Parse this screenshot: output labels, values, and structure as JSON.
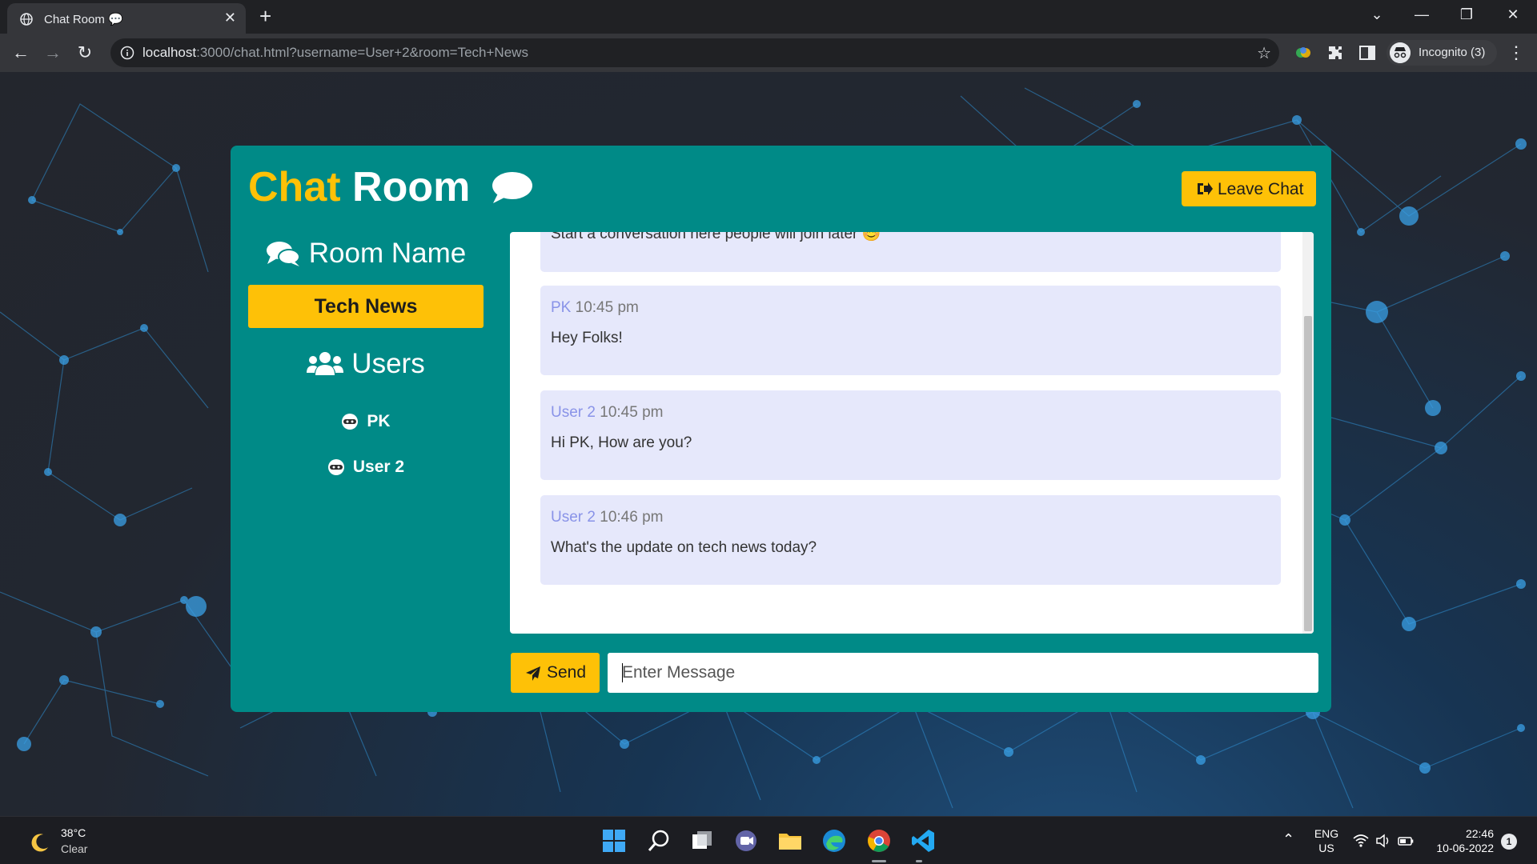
{
  "browser": {
    "tab_title": "Chat Room 💬",
    "tab_close": "✕",
    "new_tab": "+",
    "url_host": "localhost",
    "url_rest": ":3000/chat.html?username=User+2&room=Tech+News",
    "incognito_label": "Incognito (3)",
    "window_controls": [
      "⌄",
      "—",
      "❐",
      "✕"
    ]
  },
  "app": {
    "title_part1": "Chat",
    "title_part2": "Room",
    "leave_label": "Leave Chat",
    "room_heading": "Room Name",
    "room_name": "Tech News",
    "users_heading": "Users",
    "users": [
      "PK",
      "User 2"
    ],
    "partial_message": "Start a conversation here people will join later 😊",
    "messages": [
      {
        "user": "PK",
        "time": "10:45 pm",
        "text": "Hey Folks!"
      },
      {
        "user": "User 2",
        "time": "10:45 pm",
        "text": "Hi PK, How are you?"
      },
      {
        "user": "User 2",
        "time": "10:46 pm",
        "text": "What's the update on tech news today?"
      }
    ],
    "send_label": "Send",
    "input_placeholder": "Enter Message",
    "colors": {
      "accent": "#fec107",
      "panel": "#008a87",
      "message_bg": "#e6e8fb",
      "username": "#8993e8"
    }
  },
  "taskbar": {
    "temperature": "38°C",
    "weather": "Clear",
    "lang_top": "ENG",
    "lang_bottom": "US",
    "time": "22:46",
    "date": "10-06-2022",
    "notifications": "1",
    "apps": [
      "start-icon",
      "search-icon",
      "task-view-icon",
      "chat-icon",
      "file-explorer-icon",
      "edge-icon",
      "chrome-icon",
      "vscode-icon"
    ]
  }
}
